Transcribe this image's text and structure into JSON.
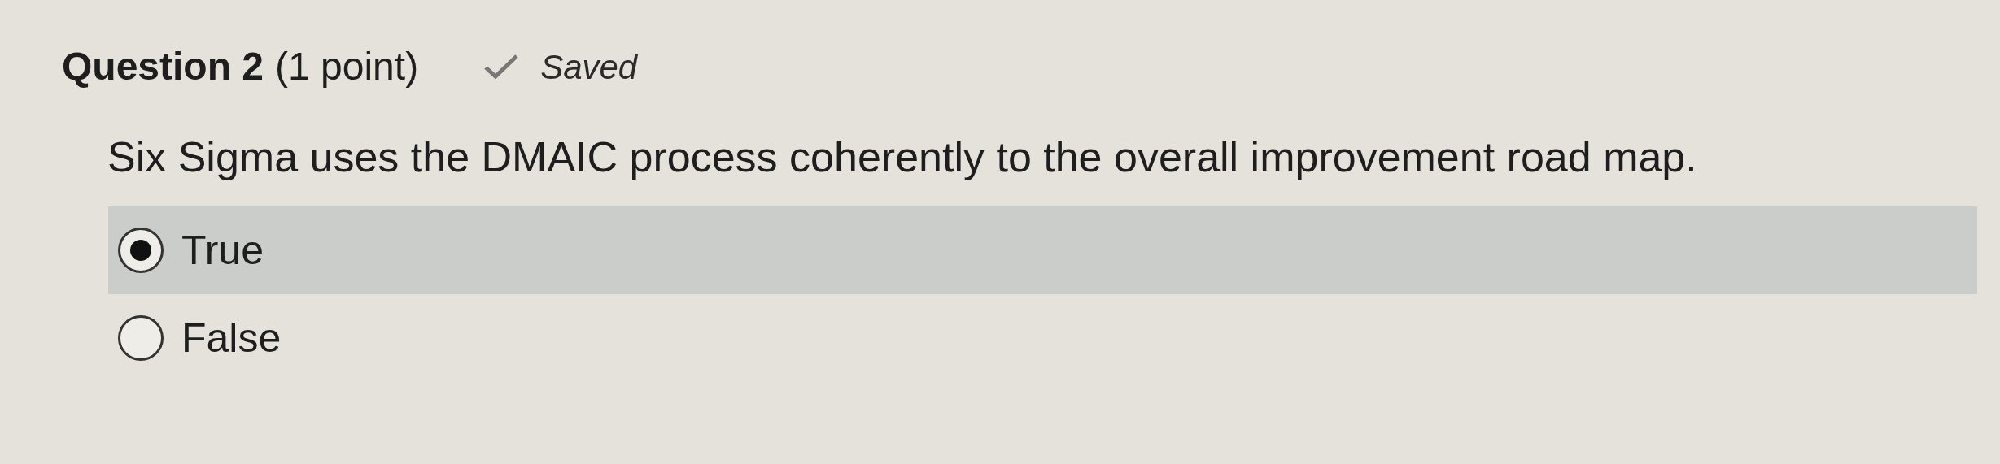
{
  "question": {
    "title": "Question 2",
    "points": "(1 point)",
    "status": "Saved",
    "prompt": "Six Sigma uses the DMAIC process coherently to the overall improvement road map.",
    "options": [
      {
        "label": "True",
        "selected": true
      },
      {
        "label": "False",
        "selected": false
      }
    ]
  }
}
